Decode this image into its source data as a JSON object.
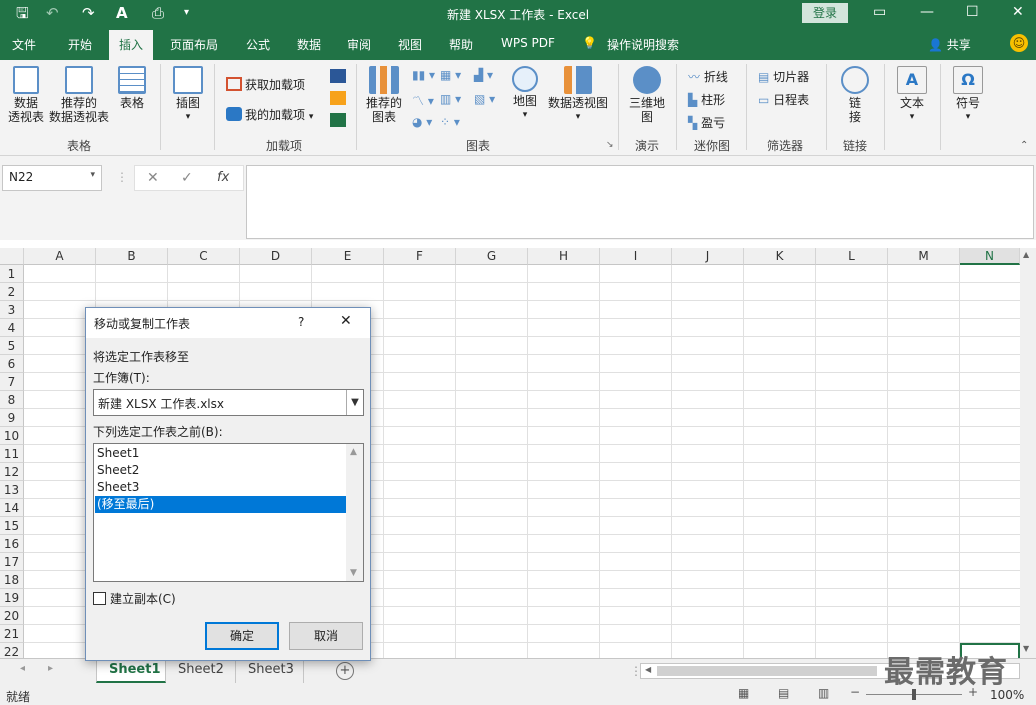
{
  "window": {
    "title": "新建 XLSX 工作表  -  Excel",
    "login": "登录"
  },
  "qat_icons": [
    "save-icon",
    "undo-icon",
    "redo-icon",
    "font-color-icon",
    "print-preview-icon",
    "customize-qat-icon"
  ],
  "tabs": [
    "文件",
    "开始",
    "插入",
    "页面布局",
    "公式",
    "数据",
    "审阅",
    "视图",
    "帮助",
    "WPS PDF",
    "操作说明搜索"
  ],
  "active_tab": "插入",
  "share": "共享",
  "ribbon": {
    "table_group": {
      "label": "表格",
      "pivot": "数据\n透视表",
      "recommended_pivot": "推荐的\n数据透视表",
      "table": "表格"
    },
    "illustrations": {
      "label": "插图"
    },
    "addins": {
      "label": "加载项",
      "get": "获取加载项",
      "mine": "我的加载项"
    },
    "charts": {
      "label": "图表",
      "recommended": "推荐的\n图表",
      "map": "地图",
      "pivot_chart": "数据透视图"
    },
    "tours": {
      "label": "演示",
      "map3d": "三维地\n图"
    },
    "sparklines": {
      "label": "迷你图",
      "line": "折线",
      "column": "柱形",
      "winloss": "盈亏"
    },
    "filters": {
      "label": "筛选器",
      "slicer": "切片器",
      "timeline": "日程表"
    },
    "links": {
      "label": "链接",
      "link": "链\n接"
    },
    "text": {
      "label": "文本"
    },
    "symbols": {
      "label": "符号"
    }
  },
  "namebox": "N22",
  "formula_buttons": {
    "cancel": "✕",
    "enter": "✓",
    "fx": "fx"
  },
  "columns": [
    "A",
    "B",
    "C",
    "D",
    "E",
    "F",
    "G",
    "H",
    "I",
    "J",
    "K",
    "L",
    "M",
    "N"
  ],
  "selected_column": "N",
  "rows": [
    "1",
    "2",
    "3",
    "4",
    "5",
    "6",
    "7",
    "8",
    "9",
    "10",
    "11",
    "12",
    "13",
    "14",
    "15",
    "16",
    "17",
    "18",
    "19",
    "20",
    "21",
    "22"
  ],
  "sheets": [
    "Sheet1",
    "Sheet2",
    "Sheet3"
  ],
  "active_sheet": "Sheet1",
  "status": {
    "text": "就绪",
    "zoom": "100%"
  },
  "dialog": {
    "title": "移动或复制工作表",
    "help": "?",
    "move_to_label": "将选定工作表移至",
    "workbook_label": "工作簿(T):",
    "workbook_value": "新建 XLSX 工作表.xlsx",
    "before_label": "下列选定工作表之前(B):",
    "list": [
      "Sheet1",
      "Sheet2",
      "Sheet3",
      "(移至最后)"
    ],
    "selected_item": "(移至最后)",
    "copy_label": "建立副本(C)",
    "ok": "确定",
    "cancel": "取消"
  },
  "watermark": "最需教育",
  "colors": {
    "brand": "#217346",
    "select": "#0078d7"
  }
}
